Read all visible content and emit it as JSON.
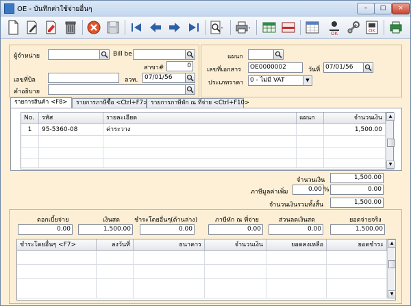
{
  "window": {
    "title": "OE - บันทึกค่าใช้จ่ายอื่นๆ",
    "min": "–",
    "max": "□",
    "close": "×"
  },
  "toolbar": {
    "buttons": [
      "new-document-icon",
      "edit-icon",
      "erase-icon",
      "delete-icon",
      "cancel-icon",
      "save-icon",
      "first-record-icon",
      "previous-record-icon",
      "next-record-icon",
      "last-record-icon",
      "search-icon",
      "print-icon",
      "excel-icon",
      "report-icon",
      "calendar-icon",
      "approve-icon",
      "tools-icon",
      "confirm-icon",
      "exit-icon"
    ],
    "ok1": "OK",
    "ok2": "OK"
  },
  "header_left": {
    "vendor_label": "ผู้จำหน่าย",
    "vendor_value": "",
    "billbe_label": "Bill be",
    "billbe_value": "",
    "branch_label": "สาขา#",
    "branch_value": "0",
    "bill_no_label": "เลขที่บิล",
    "bill_no_value": "",
    "bill_date_label": "ลวท.",
    "bill_date_value": "07/01/56",
    "desc_label": "คำอธิบาย",
    "desc_value": ""
  },
  "header_right": {
    "dept_label": "แผนก",
    "dept_value": "",
    "docno_label": "เลขที่เอกสาร",
    "docno_value": "OE0000002",
    "date_label": "วันที่",
    "date_value": "07/01/56",
    "pricetype_label": "ประเภทราคา",
    "pricetype_value": "0 - ไม่มี VAT"
  },
  "tabs": [
    {
      "label": "รายการสินค้า <F8>"
    },
    {
      "label": "รายการภาษีซื้อ <Ctrl+F7>"
    },
    {
      "label": "รายการภาษีหัก ณ ที่จ่าย <Ctrl+F10>"
    }
  ],
  "items_grid": {
    "columns": [
      "No.",
      "รหัส",
      "รายละเอียด",
      "แผนก",
      "จำนวนเงิน"
    ],
    "rows": [
      {
        "no": "1",
        "code": "95-5360-08",
        "desc": "ค่าระวาง",
        "dept": "",
        "amount": "1,500.00"
      }
    ]
  },
  "totals": {
    "amount_label": "จำนวนเงิน",
    "amount_value": "1,500.00",
    "vat_label": "ภาษีมูลค่าเพิ่ม",
    "vat_rate": "0.00",
    "vat_pct": "%",
    "vat_value": "0.00",
    "total_label": "จำนวนเงินรวมทั้งสิ้น",
    "total_value": "1,500.00"
  },
  "payment": {
    "interest_label": "ดอกเบี้ยจ่าย",
    "interest_value": "0.00",
    "cash_label": "เงินสด",
    "cash_value": "1,500.00",
    "other_label": "ชำระโดยอื่นๆ(ด้านล่าง)",
    "other_value": "0.00",
    "wht_label": "ภาษีหัก ณ ที่จ่าย",
    "wht_value": "0.00",
    "discount_label": "ส่วนลดเงินสด",
    "discount_value": "0.00",
    "actual_label": "ยอดจ่ายจริง",
    "actual_value": "1,500.00"
  },
  "payment_grid": {
    "columns": [
      "ชำระโดยอื่นๆ <F7>",
      "ลงวันที่",
      "ธนาคาร",
      "จำนวนเงิน",
      "ยอดคงเหลือ",
      "ยอดชำระ"
    ]
  }
}
